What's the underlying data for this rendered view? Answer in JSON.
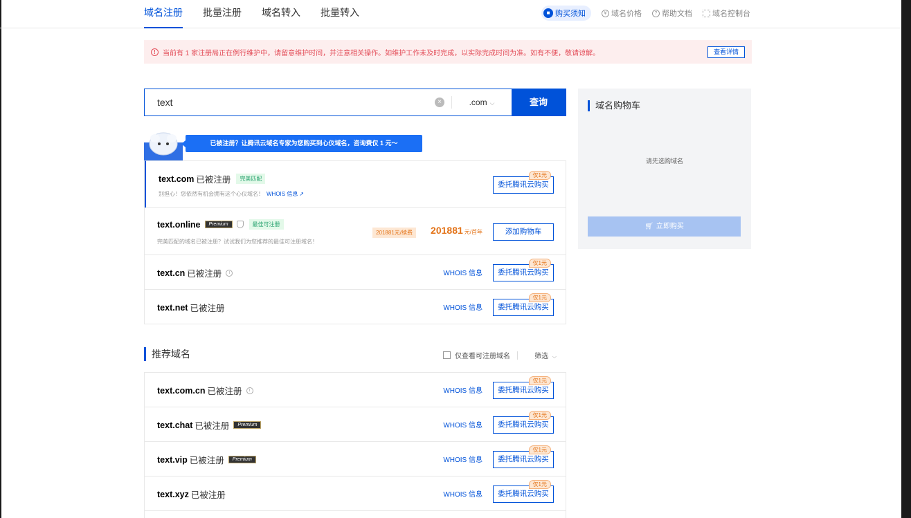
{
  "nav": {
    "tabs": [
      "域名注册",
      "批量注册",
      "域名转入",
      "批量转入"
    ],
    "active_tab": 0
  },
  "top_links": {
    "buy_notice": "购买须知",
    "price": "域名价格",
    "help": "帮助文档",
    "console": "域名控制台"
  },
  "alert": {
    "text": "当前有 1 家注册局正在例行维护中，请留意维护时间，并注意相关操作。如维护工作未及时完成，以实际完成时间为准。如有不便，敬请谅解。",
    "button": "查看详情"
  },
  "search": {
    "value": "text",
    "suffix": ".com",
    "button": "查询"
  },
  "promo": {
    "text": "已被注册？让腾讯云域名专家为您购买到心仪域名，咨询费仅 1 元～"
  },
  "results": [
    {
      "name": "text",
      "tld": ".com",
      "status": "已被注册",
      "tag": "完美匹配",
      "sub": "别担心！您依然有机会拥有这个心仪域名！",
      "sub_link": "WHOIS 信息",
      "button": "委托腾讯云购买",
      "badge": "仅1元"
    },
    {
      "name": "text",
      "tld": ".online",
      "premium": "Premium",
      "tag": "最佳可注册",
      "sub": "完美匹配的域名已被注册？试试我们为您推荐的最佳可注册域名！",
      "renew": "201881元/续费",
      "price": "201881",
      "price_unit": "元/首年",
      "button": "添加购物车"
    },
    {
      "name": "text",
      "tld": ".cn",
      "status": "已被注册",
      "whois": "WHOIS 信息",
      "button": "委托腾讯云购买",
      "badge": "仅1元"
    },
    {
      "name": "text",
      "tld": ".net",
      "status": "已被注册",
      "whois": "WHOIS 信息",
      "button": "委托腾讯云购买",
      "badge": "仅1元"
    }
  ],
  "recommend": {
    "title": "推荐域名",
    "checkbox_label": "仅查看可注册域名",
    "filter": "筛选",
    "items": [
      {
        "name": "text",
        "tld": ".com.cn",
        "status": "已被注册",
        "whois": "WHOIS 信息",
        "button": "委托腾讯云购买",
        "badge": "仅1元"
      },
      {
        "name": "text",
        "tld": ".chat",
        "status": "已被注册",
        "premium": "Premium",
        "whois": "WHOIS 信息",
        "button": "委托腾讯云购买",
        "badge": "仅1元"
      },
      {
        "name": "text",
        "tld": ".vip",
        "status": "已被注册",
        "premium": "Premium",
        "whois": "WHOIS 信息",
        "button": "委托腾讯云购买",
        "badge": "仅1元"
      },
      {
        "name": "text",
        "tld": ".xyz",
        "status": "已被注册",
        "whois": "WHOIS 信息",
        "button": "委托腾讯云购买",
        "badge": "仅1元"
      }
    ]
  },
  "cart": {
    "title": "域名购物车",
    "empty_text": "请先选购域名",
    "buy_button": "立即购买"
  }
}
